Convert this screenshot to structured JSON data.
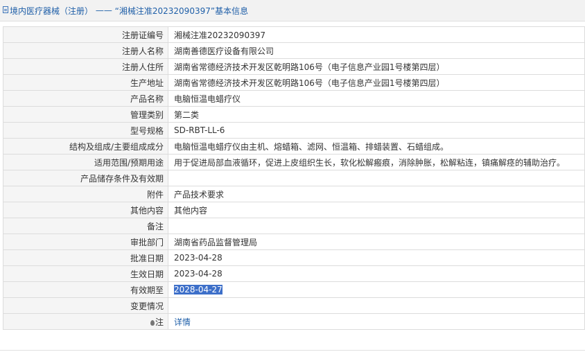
{
  "header": {
    "category": "境内医疗器械（注册）",
    "separator": " —— ",
    "title": "“湘械注准20232090397”基本信息"
  },
  "rows": [
    {
      "label": "注册证编号",
      "value": "湘械注准20232090397"
    },
    {
      "label": "注册人名称",
      "value": "湖南善德医疗设备有限公司"
    },
    {
      "label": "注册人住所",
      "value": "湖南省常德经济技术开发区乾明路106号（电子信息产业园1号楼第四层）"
    },
    {
      "label": "生产地址",
      "value": "湖南省常德经济技术开发区乾明路106号（电子信息产业园1号楼第四层）"
    },
    {
      "label": "产品名称",
      "value": "电脑恒温电蜡疗仪"
    },
    {
      "label": "管理类别",
      "value": "第二类"
    },
    {
      "label": "型号规格",
      "value": "SD-RBT-LL-6"
    },
    {
      "label": "结构及组成/主要组成成分",
      "value": "电脑恒温电蜡疗仪由主机、熔蜡箱、滤网、恒温箱、排蜡装置、石蜡组成。"
    },
    {
      "label": "适用范围/预期用途",
      "value": "用于促进局部血液循环，促进上皮组织生长，软化松解瘢痕，消除肿胀，松解粘连，镇痛解痉的辅助治疗。"
    },
    {
      "label": "产品储存条件及有效期",
      "value": ""
    },
    {
      "label": "附件",
      "value": "产品技术要求"
    },
    {
      "label": "其他内容",
      "value": "其他内容"
    },
    {
      "label": "备注",
      "value": ""
    },
    {
      "label": "审批部门",
      "value": "湖南省药品监督管理局"
    },
    {
      "label": "批准日期",
      "value": "2023-04-28"
    },
    {
      "label": "生效日期",
      "value": "2023-04-28"
    },
    {
      "label": "有效期至",
      "value": "2028-04-27"
    },
    {
      "label": "变更情况",
      "value": ""
    }
  ],
  "note": {
    "label": "注",
    "link": "详情"
  }
}
